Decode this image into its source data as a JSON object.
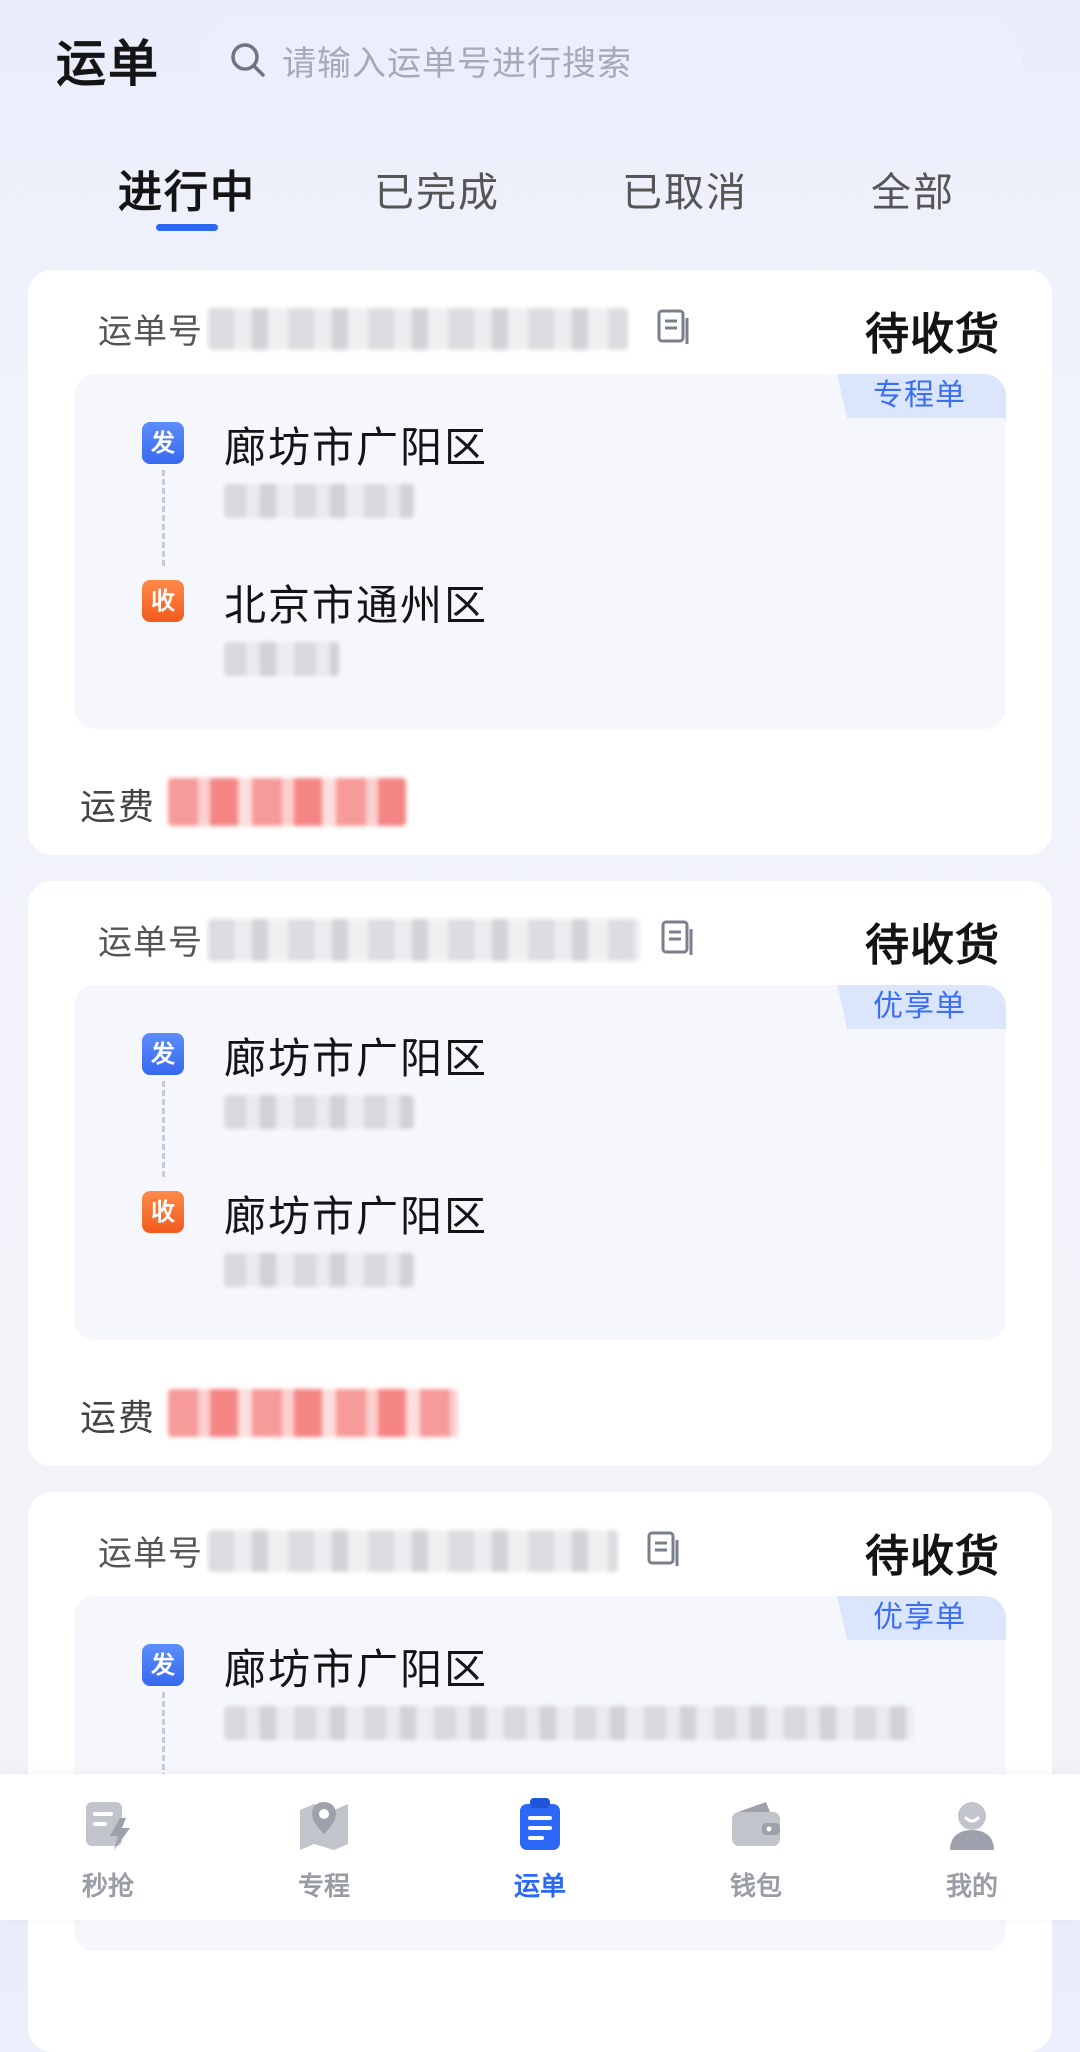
{
  "header": {
    "title": "运单",
    "search_placeholder": "请输入运单号进行搜索"
  },
  "tabs": [
    {
      "label": "进行中",
      "active": true
    },
    {
      "label": "已完成",
      "active": false
    },
    {
      "label": "已取消",
      "active": false
    },
    {
      "label": "全部",
      "active": false
    }
  ],
  "orders": [
    {
      "number_label": "运单号",
      "status": "待收货",
      "type": "专程单",
      "from": {
        "badge": "发",
        "city": "廊坊市广阳区"
      },
      "to": {
        "badge": "收",
        "city": "北京市通州区"
      },
      "fee_label": "运费"
    },
    {
      "number_label": "运单号",
      "status": "待收货",
      "type": "优享单",
      "from": {
        "badge": "发",
        "city": "廊坊市广阳区"
      },
      "to": {
        "badge": "收",
        "city": "廊坊市广阳区"
      },
      "fee_label": "运费"
    },
    {
      "number_label": "运单号",
      "status": "待收货",
      "type": "优享单",
      "from": {
        "badge": "发",
        "city": "廊坊市广阳区"
      }
    }
  ],
  "bottom_nav": [
    {
      "label": "秒抢",
      "icon": "grab-order-icon",
      "active": false
    },
    {
      "label": "专程",
      "icon": "route-map-icon",
      "active": false
    },
    {
      "label": "运单",
      "icon": "waybill-icon",
      "active": true
    },
    {
      "label": "钱包",
      "icon": "wallet-icon",
      "active": false
    },
    {
      "label": "我的",
      "icon": "profile-icon",
      "active": false
    }
  ],
  "colors": {
    "accent": "#2b68f5",
    "send_badge": "#3769ee",
    "receive_badge": "#f25a1e",
    "type_badge_bg": "#dbe6fd"
  }
}
